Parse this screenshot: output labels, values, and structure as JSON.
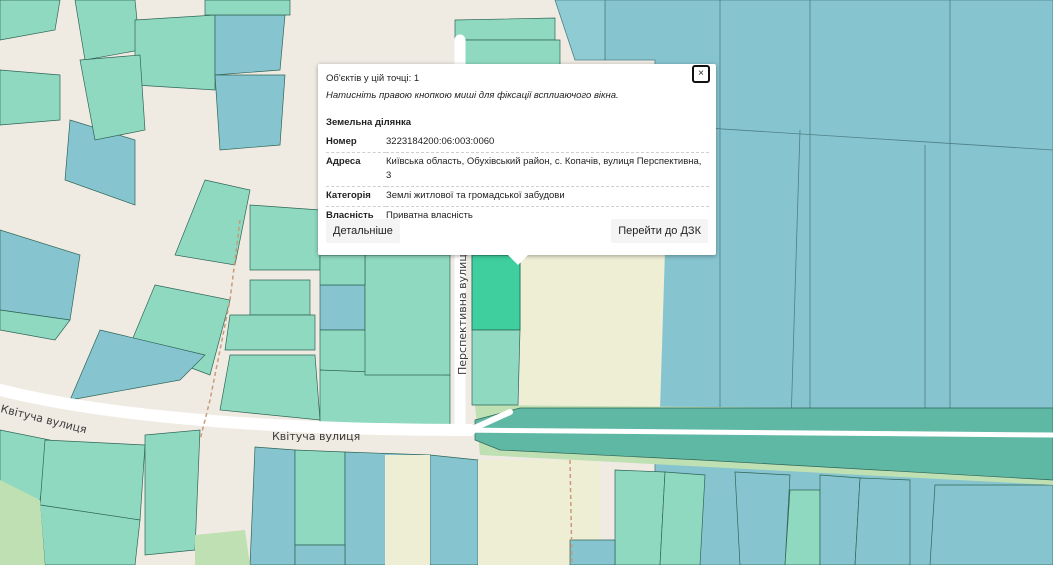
{
  "map": {
    "streets": [
      {
        "name": "Квітуча вулиця"
      },
      {
        "name": "Квітуча вулиця"
      },
      {
        "name": "Перспективна вулиця"
      }
    ],
    "colors": {
      "background": "#efebe3",
      "parcel_green": "#8fd9c0",
      "parcel_blue": "#86c4cf",
      "parcel_selected": "#3fcf9f",
      "forest": "#bfe0b3",
      "field": "#eeeed5"
    }
  },
  "popup": {
    "count_line": "Об'єктів у цій точці: 1",
    "hint": "Натисніть правою кнопкою миші для фіксації всплиаючого вікна.",
    "close_label": "×",
    "section_title": "Земельна ділянка",
    "rows": [
      {
        "key": "Номер",
        "value": "3223184200:06:003:0060"
      },
      {
        "key": "Адреса",
        "value": "Київська область, Обухівський район, с. Копачів, вулиця Перспективна, 3"
      },
      {
        "key": "Категорія",
        "value": "Землі житлової та громадської забудови"
      },
      {
        "key": "Власність",
        "value": "Приватна власність"
      }
    ],
    "details_button": "Детальніше",
    "dzk_button": "Перейти до ДЗК"
  }
}
